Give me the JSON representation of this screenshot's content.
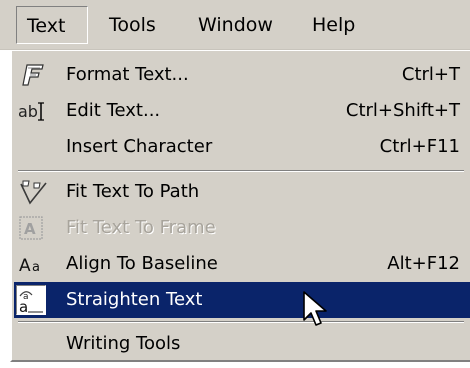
{
  "menubar": {
    "items": [
      {
        "label": "Text"
      },
      {
        "label": "Tools"
      },
      {
        "label": "Window"
      },
      {
        "label": "Help"
      }
    ]
  },
  "text_menu": {
    "items": [
      {
        "label": "Format Text...",
        "shortcut": "Ctrl+T",
        "icon": "format-text-icon"
      },
      {
        "label": "Edit Text...",
        "shortcut": "Ctrl+Shift+T",
        "icon": "edit-text-icon"
      },
      {
        "label": "Insert Character",
        "shortcut": "Ctrl+F11"
      },
      {
        "label": "Fit Text To Path",
        "icon": "fit-text-to-path-icon"
      },
      {
        "label": "Fit Text To Frame",
        "icon": "fit-text-to-frame-icon",
        "disabled": true
      },
      {
        "label": "Align To Baseline",
        "shortcut": "Alt+F12",
        "icon": "align-to-baseline-icon"
      },
      {
        "label": "Straighten Text",
        "icon": "straighten-text-icon",
        "highlighted": true
      },
      {
        "label": "Writing Tools"
      }
    ]
  },
  "colors": {
    "menu_face": "#d4d0c8",
    "highlight": "#0a246a",
    "highlight_text": "#ffffff",
    "disabled_text": "#a8a49c"
  }
}
